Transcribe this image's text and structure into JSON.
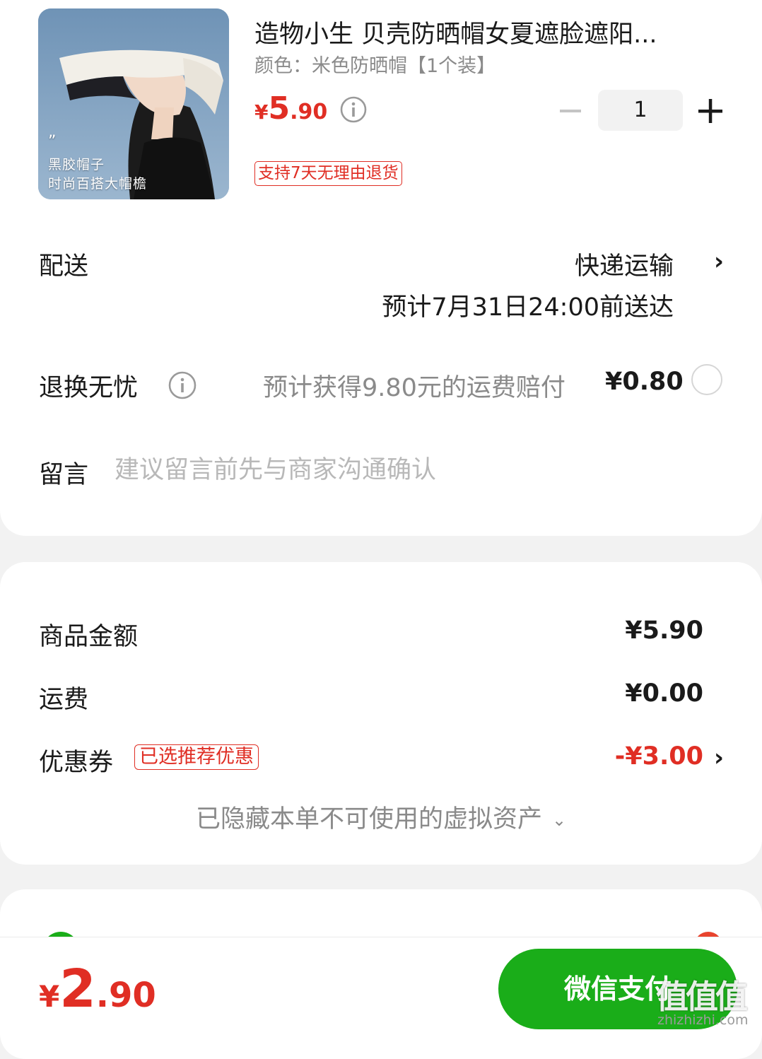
{
  "product": {
    "thumb_text_mark": "”",
    "thumb_text_1": "黑胶帽子",
    "thumb_text_2": "时尚百搭大帽檐",
    "title": "造物小生 贝壳防晒帽女夏遮脸遮阳...",
    "variant": "颜色：米色防晒帽【1个装】",
    "price_currency": "¥",
    "price_int": "5",
    "price_dec": ".90",
    "quantity": "1",
    "return_tag": "支持7天无理由退货"
  },
  "delivery": {
    "label": "配送",
    "method": "快递运输",
    "eta": "预计7月31日24:00前送达",
    "chevron": "›"
  },
  "return_insurance": {
    "label": "退换无忧",
    "description": "预计获得9.80元的运费赔付",
    "price": "¥0.80"
  },
  "note": {
    "label": "留言",
    "placeholder": "建议留言前先与商家沟通确认"
  },
  "summary": {
    "goods_label": "商品金额",
    "goods_value": "¥5.90",
    "shipping_label": "运费",
    "shipping_value": "¥0.00",
    "coupon_label": "优惠券",
    "coupon_tag": "已选推荐优惠",
    "coupon_value": "-¥3.00",
    "coupon_chevron": "›",
    "hidden_assets": "已隐藏本单不可使用的虚拟资产",
    "hidden_assets_icon": "⌄"
  },
  "footer": {
    "total_currency": "¥",
    "total_int": "2",
    "total_dec": ".90",
    "pay_button": "微信支付"
  },
  "watermark": {
    "glyphs": "值值值",
    "url": "zhizhizhi.com"
  },
  "colors": {
    "accent_red": "#e02e24",
    "wechat_green": "#1aad19",
    "background": "#f2f2f2"
  },
  "icons": [
    "info-icon",
    "minus-icon",
    "plus-icon",
    "chevron-right-icon",
    "radio-icon",
    "chevron-down-icon",
    "wechat-pay-icon"
  ]
}
